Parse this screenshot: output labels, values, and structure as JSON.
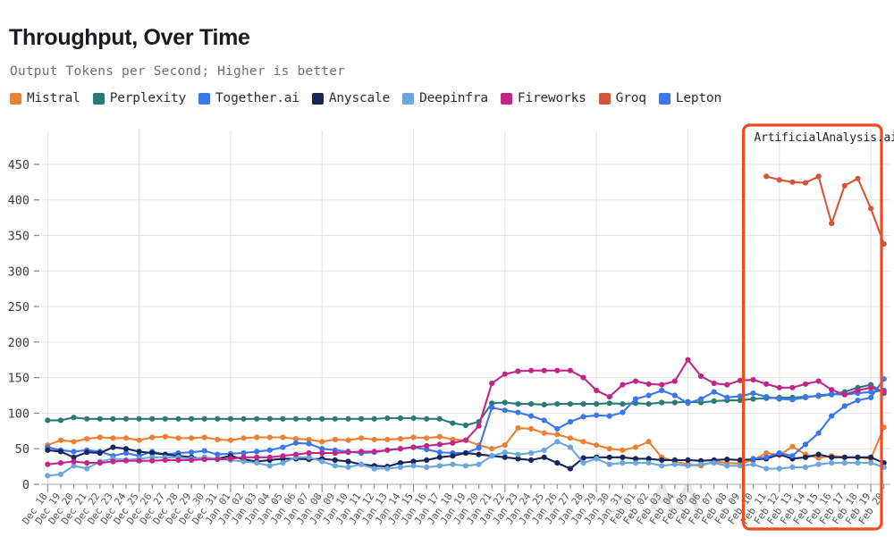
{
  "header": {
    "title": "Throughput, Over Time",
    "subtitle": "Output Tokens per Second; Higher is better"
  },
  "annotation": {
    "label": "ArtificialAnalysis.ai",
    "box_color": "#F04A23",
    "start_category": "Feb 10",
    "end_category": "Feb 20"
  },
  "watermark": {
    "text": "AA"
  },
  "chart_data": {
    "type": "line",
    "title": "Throughput, Over Time",
    "subtitle": "Output Tokens per Second; Higher is better",
    "xlabel": "",
    "ylabel": "",
    "ylim": [
      0,
      470
    ],
    "yticks": [
      0,
      50,
      100,
      150,
      200,
      250,
      300,
      350,
      400,
      450
    ],
    "grid": true,
    "legend_position": "top-left",
    "categories": [
      "Dec 18",
      "Dec 19",
      "Dec 20",
      "Dec 21",
      "Dec 22",
      "Dec 23",
      "Dec 24",
      "Dec 25",
      "Dec 26",
      "Dec 27",
      "Dec 28",
      "Dec 29",
      "Dec 30",
      "Dec 31",
      "Jan 01",
      "Jan 02",
      "Jan 03",
      "Jan 04",
      "Jan 05",
      "Jan 06",
      "Jan 07",
      "Jan 08",
      "Jan 09",
      "Jan 10",
      "Jan 11",
      "Jan 12",
      "Jan 13",
      "Jan 14",
      "Jan 15",
      "Jan 16",
      "Jan 17",
      "Jan 18",
      "Jan 19",
      "Jan 20",
      "Jan 21",
      "Jan 22",
      "Jan 23",
      "Jan 24",
      "Jan 25",
      "Jan 26",
      "Jan 27",
      "Jan 28",
      "Jan 29",
      "Jan 30",
      "Jan 31",
      "Feb 01",
      "Feb 02",
      "Feb 03",
      "Feb 04",
      "Feb 05",
      "Feb 06",
      "Feb 07",
      "Feb 08",
      "Feb 09",
      "Feb 10",
      "Feb 11",
      "Feb 12",
      "Feb 13",
      "Feb 14",
      "Feb 15",
      "Feb 16",
      "Feb 17",
      "Feb 18",
      "Feb 19",
      "Feb 20"
    ],
    "series": [
      {
        "name": "Mistral",
        "color": "#EE8033",
        "values": [
          55,
          62,
          60,
          64,
          66,
          65,
          65,
          62,
          66,
          67,
          65,
          65,
          66,
          63,
          62,
          65,
          66,
          66,
          66,
          64,
          63,
          60,
          63,
          62,
          65,
          63,
          63,
          64,
          66,
          65,
          67,
          63,
          62,
          55,
          50,
          55,
          79,
          78,
          72,
          70,
          65,
          60,
          55,
          50,
          48,
          52,
          60,
          38,
          32,
          28,
          26,
          32,
          30,
          29,
          34,
          44,
          41,
          53,
          42,
          37,
          40,
          38,
          38,
          36,
          80
        ]
      },
      {
        "name": "Perplexity",
        "color": "#2C7A76",
        "values": [
          90,
          90,
          94,
          92,
          92,
          92,
          92,
          92,
          92,
          92,
          92,
          92,
          92,
          92,
          92,
          92,
          92,
          92,
          92,
          92,
          92,
          92,
          92,
          92,
          92,
          92,
          93,
          93,
          93,
          92,
          92,
          86,
          83,
          88,
          114,
          115,
          113,
          113,
          112,
          113,
          113,
          113,
          113,
          114,
          113,
          114,
          113,
          115,
          115,
          116,
          115,
          117,
          118,
          118,
          120,
          121,
          122,
          122,
          123,
          124,
          126,
          130,
          136,
          140,
          128
        ]
      },
      {
        "name": "Together.ai",
        "color": "#3B76EF",
        "values": [
          52,
          48,
          46,
          48,
          46,
          40,
          44,
          40,
          46,
          42,
          44,
          45,
          47,
          42,
          43,
          44,
          46,
          48,
          52,
          58,
          57,
          50,
          48,
          46,
          44,
          45,
          48,
          50,
          52,
          49,
          45,
          44,
          44,
          51,
          108,
          104,
          101,
          96,
          90,
          78,
          88,
          95,
          97,
          96,
          101,
          120,
          125,
          132,
          125,
          114,
          120,
          130,
          122,
          124,
          128,
          123,
          120,
          119,
          122,
          125,
          127,
          126,
          128,
          130,
          132
        ]
      },
      {
        "name": "Anyscale",
        "color": "#17275C",
        "values": [
          48,
          46,
          38,
          45,
          44,
          52,
          50,
          46,
          44,
          42,
          40,
          38,
          36,
          36,
          40,
          35,
          32,
          34,
          36,
          36,
          35,
          36,
          34,
          32,
          28,
          26,
          25,
          30,
          32,
          34,
          38,
          40,
          44,
          42,
          40,
          38,
          36,
          34,
          38,
          30,
          22,
          37,
          38,
          38,
          38,
          36,
          36,
          34,
          34,
          34,
          33,
          34,
          35,
          34,
          35,
          36,
          42,
          36,
          38,
          42,
          38,
          38,
          38,
          38,
          30
        ]
      },
      {
        "name": "Deepinfra",
        "color": "#6CA6DC",
        "values": [
          12,
          14,
          26,
          22,
          32,
          36,
          34,
          36,
          38,
          38,
          38,
          36,
          38,
          36,
          34,
          32,
          30,
          26,
          30,
          38,
          38,
          32,
          26,
          24,
          28,
          22,
          22,
          24,
          26,
          24,
          26,
          28,
          26,
          28,
          40,
          45,
          42,
          44,
          48,
          60,
          52,
          30,
          36,
          28,
          30,
          30,
          30,
          26,
          28,
          26,
          28,
          30,
          26,
          26,
          28,
          22,
          22,
          24,
          24,
          28,
          30,
          30,
          30,
          30,
          24
        ]
      },
      {
        "name": "Fireworks",
        "color": "#C2268B",
        "values": [
          28,
          30,
          32,
          30,
          30,
          32,
          33,
          33,
          33,
          34,
          34,
          34,
          35,
          35,
          36,
          38,
          38,
          38,
          40,
          42,
          44,
          44,
          44,
          45,
          46,
          46,
          48,
          50,
          52,
          54,
          56,
          58,
          62,
          82,
          142,
          155,
          159,
          160,
          160,
          160,
          160,
          150,
          132,
          123,
          140,
          145,
          141,
          140,
          145,
          175,
          152,
          142,
          140,
          146,
          147,
          141,
          136,
          136,
          141,
          145,
          133,
          126,
          132,
          136,
          130
        ]
      },
      {
        "name": "Groq",
        "color": "#D3563A",
        "values": [
          null,
          null,
          null,
          null,
          null,
          null,
          null,
          null,
          null,
          null,
          null,
          null,
          null,
          null,
          null,
          null,
          null,
          null,
          null,
          null,
          null,
          null,
          null,
          null,
          null,
          null,
          null,
          null,
          null,
          null,
          null,
          null,
          null,
          null,
          null,
          null,
          null,
          null,
          null,
          null,
          null,
          null,
          null,
          null,
          null,
          null,
          null,
          null,
          null,
          null,
          null,
          null,
          null,
          null,
          null,
          433,
          428,
          425,
          424,
          433,
          367,
          420,
          430,
          388,
          338
        ]
      },
      {
        "name": "Lepton",
        "color": "#3B76EF",
        "values": [
          null,
          null,
          null,
          null,
          null,
          null,
          null,
          null,
          null,
          null,
          null,
          null,
          null,
          null,
          null,
          null,
          null,
          null,
          null,
          null,
          null,
          null,
          null,
          null,
          null,
          null,
          null,
          null,
          null,
          null,
          null,
          null,
          null,
          null,
          null,
          null,
          null,
          null,
          null,
          null,
          null,
          null,
          null,
          null,
          null,
          null,
          null,
          null,
          null,
          null,
          null,
          null,
          null,
          null,
          36,
          38,
          44,
          40,
          56,
          72,
          96,
          110,
          118,
          122,
          148
        ]
      }
    ]
  }
}
